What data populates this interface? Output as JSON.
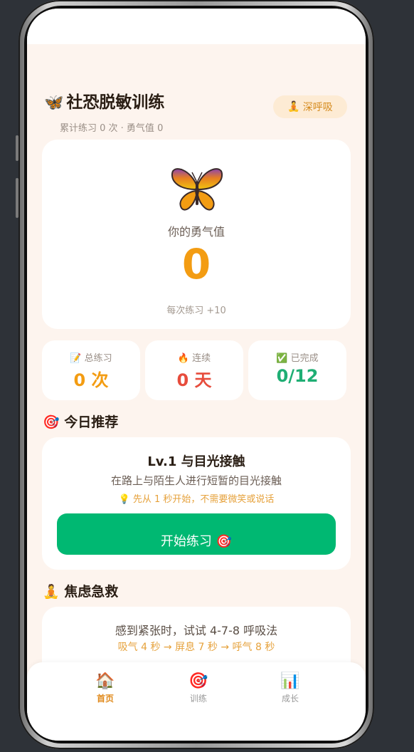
{
  "app": {
    "title": "社恐脱敏训练",
    "title_icon": "butterfly-icon",
    "subtitle": "累计练习 0 次 · 勇气值 0",
    "breath_button": {
      "icon": "meditation-icon",
      "label": "深呼吸"
    }
  },
  "courage": {
    "icon": "butterfly-icon",
    "label": "你的勇气值",
    "value": "0",
    "hint": "每次练习 +10"
  },
  "stats": [
    {
      "icon": "memo-icon",
      "label": "总练习",
      "value": "0 次",
      "color": "#f39c12"
    },
    {
      "icon": "fire-icon",
      "label": "连续",
      "value": "0 天",
      "color": "#e74c3c"
    },
    {
      "icon": "check-icon",
      "label": "已完成",
      "value": "0/12",
      "color": "#1fae74"
    }
  ],
  "recommend": {
    "section_title": "今日推荐",
    "section_icon": "target-icon",
    "level_title": "Lv.1 与目光接触",
    "description": "在路上与陌生人进行短暂的目光接触",
    "tip": "💡 先从 1 秒开始，不需要微笑或说话",
    "start_button": "开始练习 🎯"
  },
  "anxiety": {
    "section_title": "焦虑急救",
    "section_icon": "meditation-icon",
    "line1": "感到紧张时，试试 4-7-8 呼吸法",
    "line2": "吸气 4 秒 → 屏息 7 秒 → 呼气 8 秒"
  },
  "nav": [
    {
      "icon": "house-icon",
      "label": "首页",
      "active": true,
      "color": "#e08a1c"
    },
    {
      "icon": "target-icon",
      "label": "训练",
      "active": false,
      "color": "#9a9a9a"
    },
    {
      "icon": "bar-chart-icon",
      "label": "成长",
      "active": false,
      "color": "#9a9a9a"
    }
  ],
  "colors": {
    "background": "#fdf4ee",
    "accent_orange": "#f39c12",
    "accent_green": "#00b872"
  }
}
